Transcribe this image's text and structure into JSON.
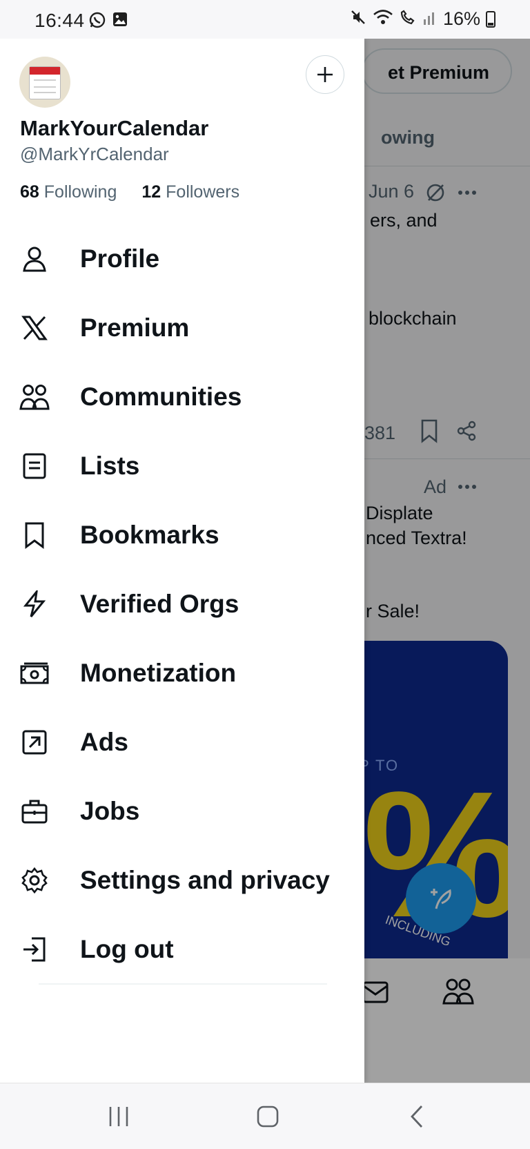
{
  "status_bar": {
    "time": "16:44",
    "battery": "16%",
    "left_icons": [
      "whatsapp-icon",
      "gallery-icon"
    ],
    "right_icons": [
      "mute-icon",
      "wifi-icon",
      "wifi-call-icon",
      "signal-icon",
      "battery-icon"
    ]
  },
  "drawer": {
    "display_name": "MarkYourCalendar",
    "handle": "@MarkYrCalendar",
    "following_count": "68",
    "following_label": "Following",
    "followers_count": "12",
    "followers_label": "Followers",
    "menu": [
      {
        "label": "Profile",
        "icon": "person-icon"
      },
      {
        "label": "Premium",
        "icon": "x-logo-icon"
      },
      {
        "label": "Communities",
        "icon": "communities-icon"
      },
      {
        "label": "Lists",
        "icon": "list-icon"
      },
      {
        "label": "Bookmarks",
        "icon": "bookmark-icon"
      },
      {
        "label": "Verified Orgs",
        "icon": "lightning-icon"
      },
      {
        "label": "Monetization",
        "icon": "money-icon"
      },
      {
        "label": "Ads",
        "icon": "arrow-out-icon"
      },
      {
        "label": "Jobs",
        "icon": "briefcase-icon"
      },
      {
        "label": "Settings and privacy",
        "icon": "gear-icon"
      },
      {
        "label": "Log out",
        "icon": "logout-icon"
      }
    ]
  },
  "feed": {
    "premium_button": "et Premium",
    "tab": "owing",
    "post": {
      "date": "Jun 6",
      "line1": "ers, and",
      "line2": "blockchain",
      "views": "381"
    },
    "ad": {
      "label": "Ad",
      "line1": "Displate",
      "line2": "nced Textra!",
      "line3": "r Sale!",
      "image_text_up_to": "P TO",
      "image_text_pct": "%",
      "image_text_including": "INCLUDING"
    }
  },
  "colors": {
    "text_primary": "#0f1419",
    "text_secondary": "#536471",
    "accent": "#1d9bf0",
    "scrim": "rgba(0,0,0,0.37)"
  }
}
